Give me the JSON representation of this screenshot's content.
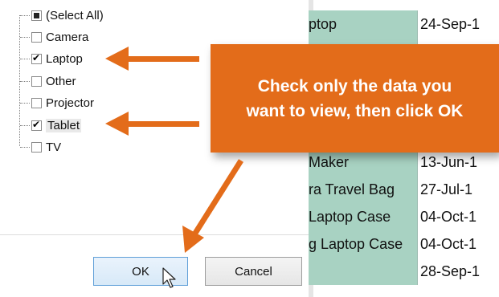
{
  "filter_list": {
    "items": [
      {
        "label": "(Select All)",
        "state": "partial"
      },
      {
        "label": "Camera",
        "state": "unchecked"
      },
      {
        "label": "Laptop",
        "state": "checked"
      },
      {
        "label": "Other",
        "state": "unchecked"
      },
      {
        "label": "Projector",
        "state": "unchecked"
      },
      {
        "label": "Tablet",
        "state": "checked"
      },
      {
        "label": "TV",
        "state": "unchecked"
      }
    ]
  },
  "buttons": {
    "ok_label": "OK",
    "cancel_label": "Cancel"
  },
  "callout": {
    "line1": "Check only the data you",
    "line2": "want to view, then click OK",
    "color": "#e36c1a"
  },
  "sheet": {
    "rows": [
      {
        "item": "ptop",
        "date": "24-Sep-1"
      },
      {
        "item": "",
        "date": ""
      },
      {
        "item": "",
        "date": ""
      },
      {
        "item": "",
        "date": ""
      },
      {
        "item": "",
        "date": ""
      },
      {
        "item": "Maker",
        "date": "13-Jun-1"
      },
      {
        "item": "ra Travel Bag",
        "date": "27-Jul-1"
      },
      {
        "item": "Laptop Case",
        "date": "04-Oct-1"
      },
      {
        "item": "g Laptop Case",
        "date": "04-Oct-1"
      },
      {
        "item": "",
        "date": "28-Sep-1"
      }
    ],
    "highlight_color": "#a8d2c2"
  }
}
